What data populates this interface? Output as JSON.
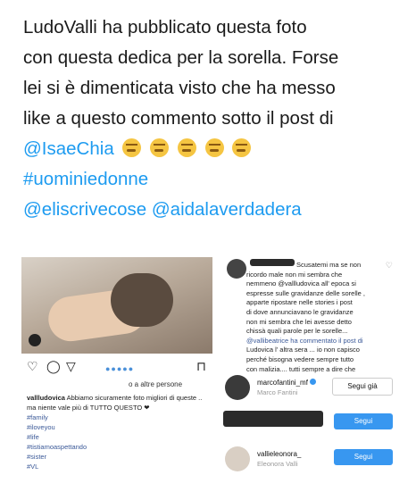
{
  "tweet": {
    "line1": "LudoValli ha pubblicato questa foto",
    "line2": "con questa dedica per la sorella. Forse",
    "line3": "lei si è dimenticata visto che ha messo",
    "line4": "like a questo commento sotto il post di",
    "mention1": "@IsaeChia",
    "hashtag": "#uominiedonne",
    "mention2": "@eliscrivecose",
    "mention3": "@aidalaverdadera",
    "emoji_icon": "downcast-face-with-sweat-emoji",
    "emoji_count": 5
  },
  "post": {
    "others_label": "o a altre persone",
    "username": "vallludovica",
    "caption": "Abbiamo sicuramente foto migliori di queste .. ma niente vale più di TUTTO QUESTO ❤",
    "hashtags": [
      "#family",
      "#iloveyou",
      "#life",
      "#tistiamoaspettando",
      "#sister",
      "#VL"
    ]
  },
  "comment": {
    "lines": [
      "Scusatemi ma se non",
      "ricordo male non mi sembra che",
      "nemmeno @vallludovica all' epoca si",
      "espresse sulle gravidanze delle sorelle ,",
      "apparte ripostare nelle stories i post",
      "di dove annunciavano le gravidanze",
      "non mi sembra che lei avesse detto",
      "chissà quali parole per le sorelle...",
      "@vallibeatrice ha commentato il post di",
      "Ludovica l' altra sera ... io non capisco",
      "perché bisogna vedere sempre tutto",
      "con malizia.... tutti sempre a dire che"
    ]
  },
  "users": [
    {
      "username": "marcofantini_mf",
      "fullname": "Marco Fantini",
      "button": "Segui già"
    },
    {
      "username": "",
      "fullname": "",
      "button": "Segui"
    },
    {
      "username": "vallieleonora_",
      "fullname": "Eleonora Valli",
      "button": "Segui"
    }
  ]
}
